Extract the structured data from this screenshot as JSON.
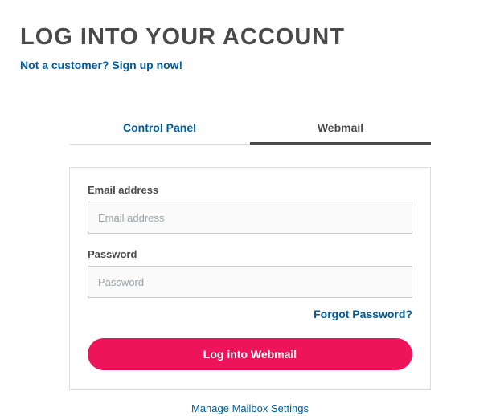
{
  "header": {
    "title": "LOG INTO YOUR ACCOUNT",
    "signup_text": "Not a customer? Sign up now!"
  },
  "tabs": {
    "control_panel": "Control Panel",
    "webmail": "Webmail"
  },
  "form": {
    "email_label": "Email address",
    "email_placeholder": "Email address",
    "password_label": "Password",
    "password_placeholder": "Password",
    "forgot": "Forgot Password?",
    "submit": "Log into Webmail"
  },
  "footer": {
    "manage": "Manage Mailbox Settings"
  }
}
